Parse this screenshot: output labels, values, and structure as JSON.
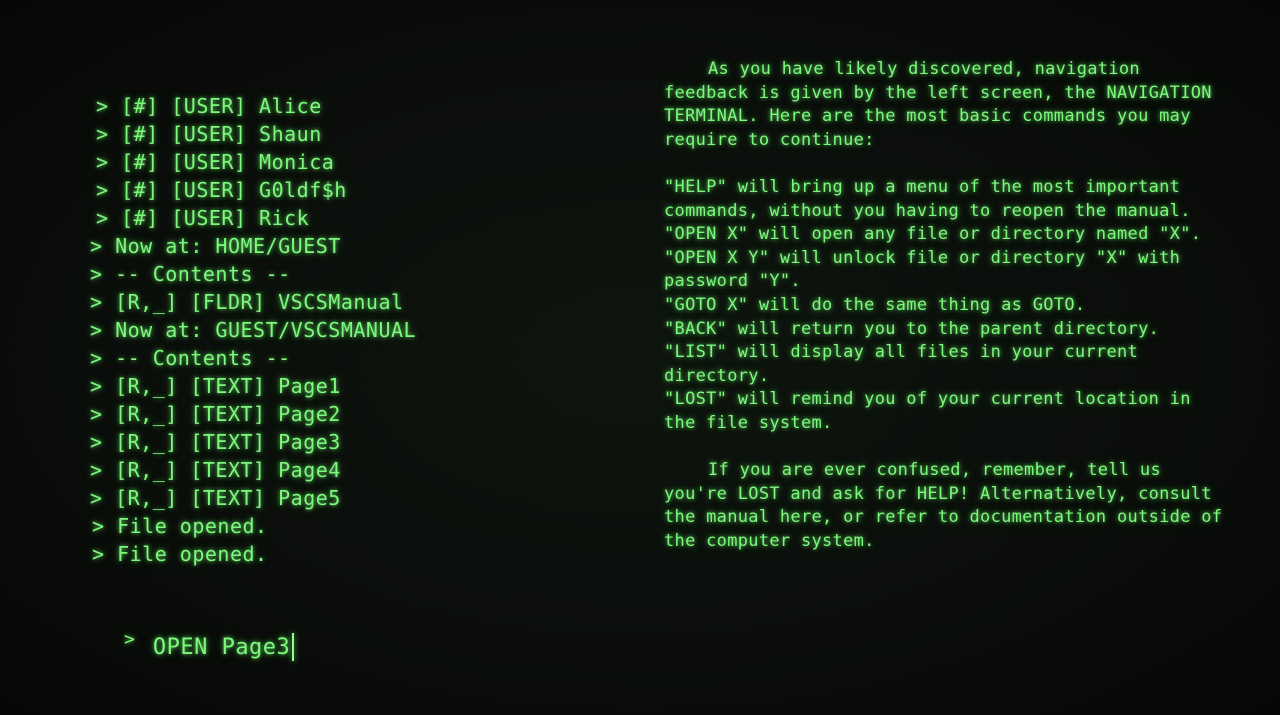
{
  "navigation_terminal": {
    "log": [
      "> [#] [USER] Alice",
      "> [#] [USER] Shaun",
      "> [#] [USER] Monica",
      "> [#] [USER] G0ldf$h",
      "> [#] [USER] Rick",
      "> Now at: HOME/GUEST",
      "> -- Contents --",
      "> [R,_] [FLDR] VSCSManual",
      "> Now at: GUEST/VSCSMANUAL",
      "> -- Contents --",
      "> [R,_] [TEXT] Page1",
      "> [R,_] [TEXT] Page2",
      "> [R,_] [TEXT] Page3",
      "> [R,_] [TEXT] Page4",
      "> [R,_] [TEXT] Page5",
      "> File opened.",
      "> File opened."
    ],
    "prompt_symbol": ">",
    "command_value": "OPEN Page3"
  },
  "manual_page": {
    "intro": "As you have likely discovered, navigation feedback is given by the left screen, the NAVIGATION TERMINAL. Here are the most basic commands you may require to continue:",
    "commands": [
      "\"HELP\" will bring up a menu of the most important commands, without you having to reopen the manual.",
      "\"OPEN X\" will open any file or directory named \"X\".",
      "\"OPEN X Y\" will unlock file or directory \"X\" with password \"Y\".",
      "\"GOTO X\" will do the same thing as GOTO.",
      "\"BACK\" will return you to the parent directory.",
      "\"LIST\" will display all files in your current directory.",
      "\"LOST\" will remind you of your current location in the file system."
    ],
    "outro": "If you are ever confused, remember, tell us you're LOST and ask for HELP! Alternatively, consult the manual here, or refer to documentation outside of the computer system."
  },
  "colors": {
    "phosphor_green": "#7df77d",
    "background": "#0a0c0a"
  }
}
